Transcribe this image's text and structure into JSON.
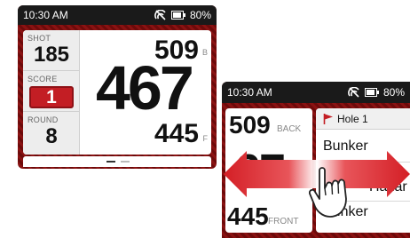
{
  "screen1": {
    "status": {
      "time": "10:30 AM",
      "battery": "80%"
    },
    "shot": {
      "label": "SHOT",
      "value": "185"
    },
    "score": {
      "label": "SCORE",
      "value": "1"
    },
    "round": {
      "label": "ROUND",
      "value": "8"
    },
    "back_distance": "509",
    "back_suffix": "B",
    "center_distance": "467",
    "front_distance": "445",
    "front_suffix": "F",
    "page_dots": 2
  },
  "screen2": {
    "status": {
      "time": "10:30 AM",
      "battery": "80%"
    },
    "back_distance": "509",
    "back_label": "BACK",
    "center_fragment": "67",
    "front_distance": "445",
    "front_label": "FRONT",
    "hole_title": "Hole 1",
    "hazards": [
      "Bunker",
      "Hazar",
      "Bunker"
    ]
  },
  "icons": [
    "no-signal-icon",
    "battery-icon",
    "flag-icon",
    "swipe-arrow-icon",
    "hand-pointer-icon"
  ],
  "colors": {
    "brand_red": "#c31e24",
    "pattern_dark": "#6d0a0a",
    "pattern_light": "#8a1212",
    "status_bar": "#1a1a1a"
  }
}
